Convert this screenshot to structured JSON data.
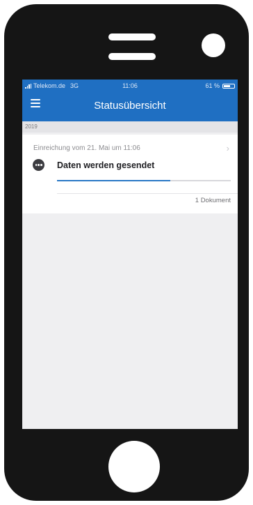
{
  "status_bar": {
    "carrier": "Telekom.de",
    "network": "3G",
    "time": "11:06",
    "battery": "61 %",
    "battery_level": 0.61
  },
  "header": {
    "title": "Statusübersicht",
    "menu_icon": "hamburger-menu-icon"
  },
  "list": {
    "section_year": "2019",
    "items": [
      {
        "date_text": "Einreichung vom 21. Mai um 11:06",
        "status_text": "Daten werden gesendet",
        "status_icon": "more-dots-icon",
        "progress": 0.65,
        "document_count": "1 Dokument",
        "chevron_icon": "chevron-right-icon"
      }
    ]
  },
  "colors": {
    "accent": "#1f6fc2",
    "progress": "#2877c6",
    "phone_frame": "#151515",
    "screen_background": "#efeff1"
  }
}
